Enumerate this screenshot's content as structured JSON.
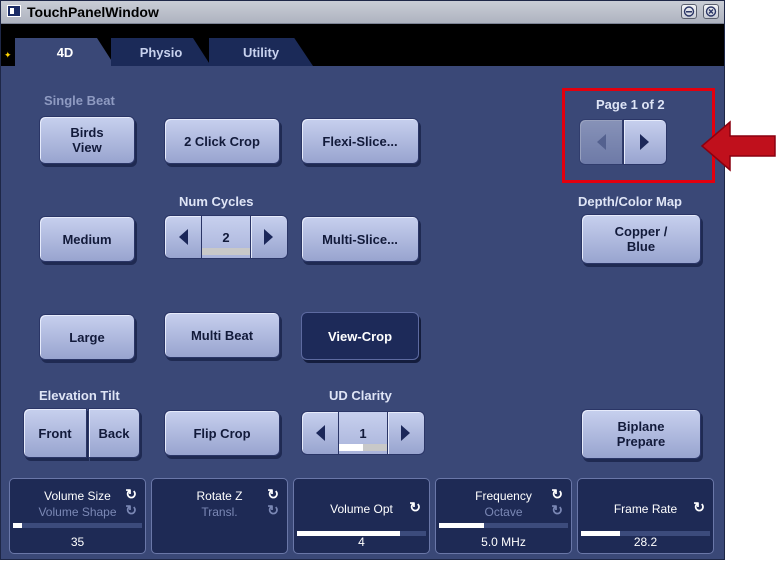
{
  "window": {
    "title": "TouchPanelWindow"
  },
  "tabs": [
    {
      "label": "4D",
      "active": true
    },
    {
      "label": "Physio",
      "active": false
    },
    {
      "label": "Utility",
      "active": false
    }
  ],
  "sections": {
    "single_beat": "Single Beat",
    "num_cycles": "Num Cycles",
    "elevation_tilt": "Elevation Tilt",
    "ud_clarity": "UD Clarity",
    "depth_color_map": "Depth/Color Map",
    "page": "Page 1 of 2"
  },
  "buttons": {
    "birds_view": "Birds\nView",
    "two_click_crop": "2 Click Crop",
    "flexi_slice": "Flexi-Slice...",
    "medium": "Medium",
    "multi_slice": "Multi-Slice...",
    "copper_blue": "Copper /\nBlue",
    "large": "Large",
    "multi_beat": "Multi Beat",
    "view_crop": "View-Crop",
    "front": "Front",
    "back": "Back",
    "flip_crop": "Flip Crop",
    "biplane_prepare": "Biplane\nPrepare"
  },
  "num_cycles": {
    "value": "2",
    "level": 0.0
  },
  "ud_clarity": {
    "value": "1",
    "level": 0.5
  },
  "bottom_controls": [
    {
      "label": "Volume Size",
      "sub": "Volume Shape",
      "value": "35",
      "level": 0.07
    },
    {
      "label": "Rotate Z",
      "sub": "Transl.",
      "value": "",
      "level": null
    },
    {
      "label": "Volume Opt",
      "sub": "",
      "value": "4",
      "level": 0.8
    },
    {
      "label": "Frequency",
      "sub": "Octave",
      "value": "5.0 MHz",
      "level": 0.35
    },
    {
      "label": "Frame Rate",
      "sub": "",
      "value": "28.2",
      "level": 0.3
    }
  ],
  "colors": {
    "panel": "#3a4877",
    "button": "#a8b3dc",
    "highlight": "#e3000e",
    "arrow": "#c0101c"
  },
  "icons": [
    "window-icon",
    "minimize-icon",
    "close-icon",
    "left-arrow-icon",
    "right-arrow-icon",
    "refresh-icon"
  ]
}
